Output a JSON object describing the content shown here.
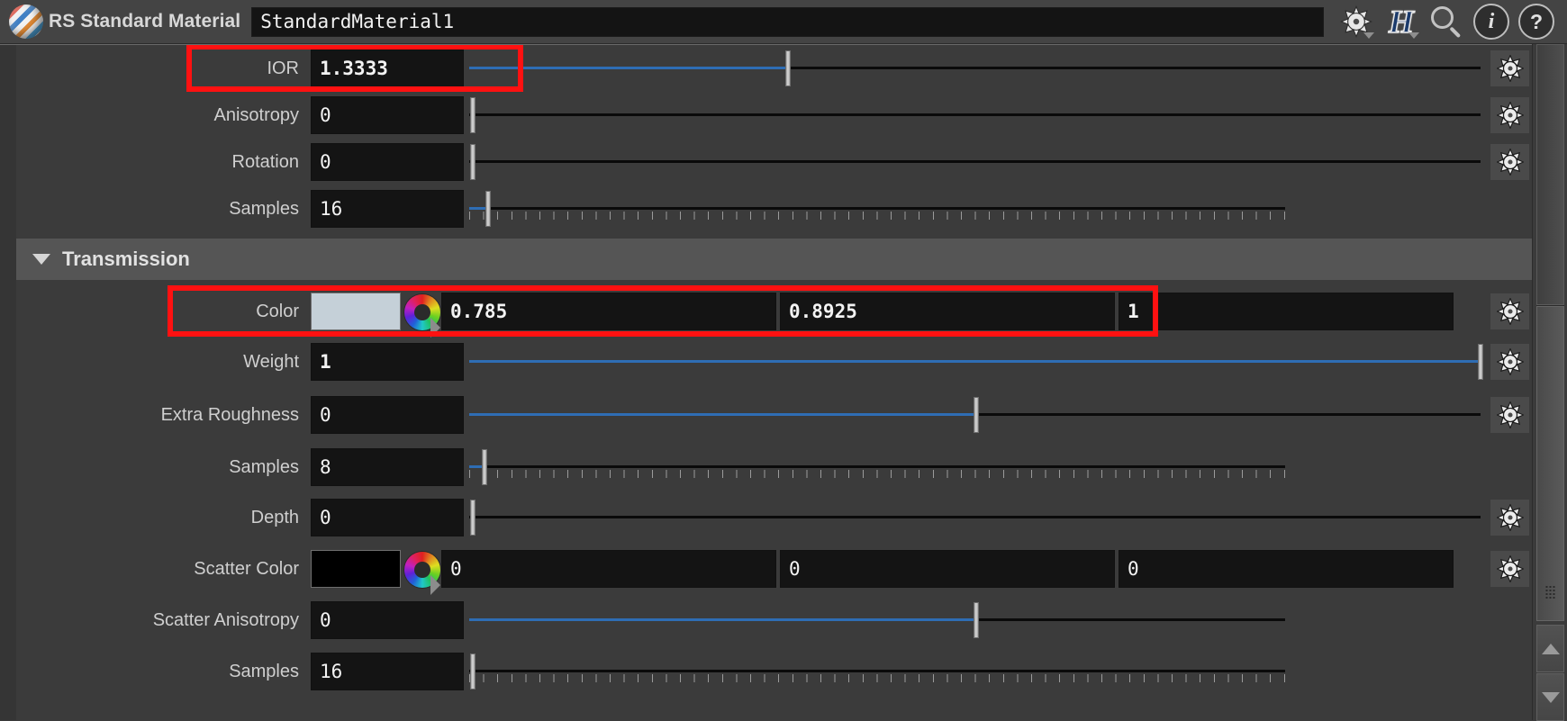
{
  "titlebar": {
    "node_type": "RS Standard Material",
    "node_name": "StandardMaterial1",
    "icons": {
      "material_sphere": "material-sphere-icon",
      "gear": "gear-icon",
      "houdini": "H",
      "search": "search-icon",
      "info": "i",
      "help": "?"
    }
  },
  "rows": [
    {
      "label": "IOR",
      "value": "1.3333",
      "bold": true,
      "slider": "bar",
      "fill_pct": 31.0,
      "highlighted": true
    },
    {
      "label": "Anisotropy",
      "value": "0",
      "bold": false,
      "slider": "bar",
      "fill_pct": 0.4,
      "highlighted": false
    },
    {
      "label": "Rotation",
      "value": "0",
      "bold": false,
      "slider": "bar",
      "fill_pct": 0.4,
      "highlighted": false
    },
    {
      "label": "Samples",
      "value": "16",
      "bold": false,
      "slider": "tick",
      "fill_pct": 1.6,
      "highlighted": false
    }
  ],
  "section": {
    "title": "Transmission",
    "expanded": true,
    "triangle": "triangle-down-icon"
  },
  "rows2": [
    {
      "label": "Weight",
      "value": "1",
      "bold": true,
      "slider": "bar",
      "fill_pct": 99.2,
      "highlighted": false
    },
    {
      "label": "Extra Roughness",
      "value": "0",
      "bold": false,
      "slider": "bar",
      "fill_pct": 49.6,
      "highlighted": false
    },
    {
      "label": "Samples",
      "value": "8",
      "bold": false,
      "slider": "tick",
      "fill_pct": 1.3,
      "highlighted": false
    },
    {
      "label": "Depth",
      "value": "0",
      "bold": false,
      "slider": "bar",
      "fill_pct": 0.4,
      "highlighted": false
    }
  ],
  "rows3": [
    {
      "label": "Scatter Anisotropy",
      "value": "0",
      "bold": false,
      "slider": "bar",
      "fill_pct": 49.6,
      "highlighted": false
    },
    {
      "label": "Samples",
      "value": "16",
      "bold": false,
      "slider": "tick",
      "fill_pct": 0.3,
      "highlighted": false
    }
  ],
  "color_rows": [
    {
      "id": "transmission-color",
      "label": "Color",
      "swatch_hex": "#c5d0d8",
      "wheel": "color-wheel-icon",
      "channels": [
        "0.785",
        "0.8925",
        "1"
      ],
      "bold": true,
      "highlighted": true
    },
    {
      "id": "scatter-color",
      "label": "Scatter Color",
      "swatch_hex": "#000000",
      "wheel": "color-wheel-icon",
      "channels": [
        "0",
        "0",
        "0"
      ],
      "bold": false,
      "highlighted": false
    }
  ],
  "gear_button": "gear-icon",
  "scrollbar": {
    "up_arrow": "arrow-up-icon",
    "down_arrow": "arrow-down-icon",
    "grip": "resize-grip-icon"
  },
  "colors": {
    "accent_blue": "#2e6db4",
    "highlight_red": "#fe1111",
    "panel_bg": "#3b3b3b",
    "field_bg": "#141414"
  }
}
